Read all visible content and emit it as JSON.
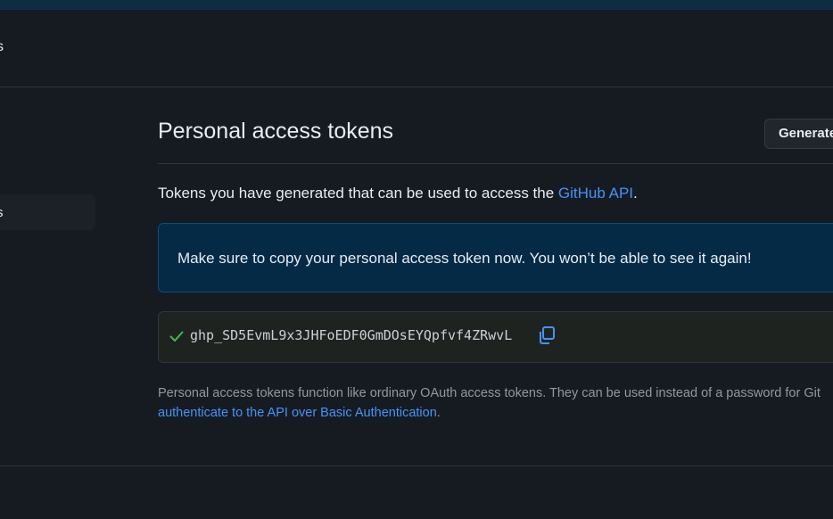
{
  "header": {
    "fragment": "s"
  },
  "sidebar": {
    "items": [
      {
        "label": "s",
        "active": true
      }
    ]
  },
  "main": {
    "title": "Personal access tokens",
    "generate_button": "Generate",
    "description": {
      "text": "Tokens you have generated that can be used to access the ",
      "link": "GitHub API",
      "suffix": "."
    },
    "flash": {
      "message": "Make sure to copy your personal access token now. You won’t be able to see it again!"
    },
    "token": {
      "value": "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",
      "status_icon": "check-icon",
      "copy_icon": "copy-icon"
    },
    "note": {
      "line1": "Personal access tokens function like ordinary OAuth access tokens. They can be used instead of a password for Git",
      "link": "authenticate to the API over Basic Authentication",
      "suffix": "."
    }
  },
  "colors": {
    "accent": "#4493f8",
    "flash_bg": "#042a45",
    "success": "#3fb950",
    "background": "#161b22"
  }
}
